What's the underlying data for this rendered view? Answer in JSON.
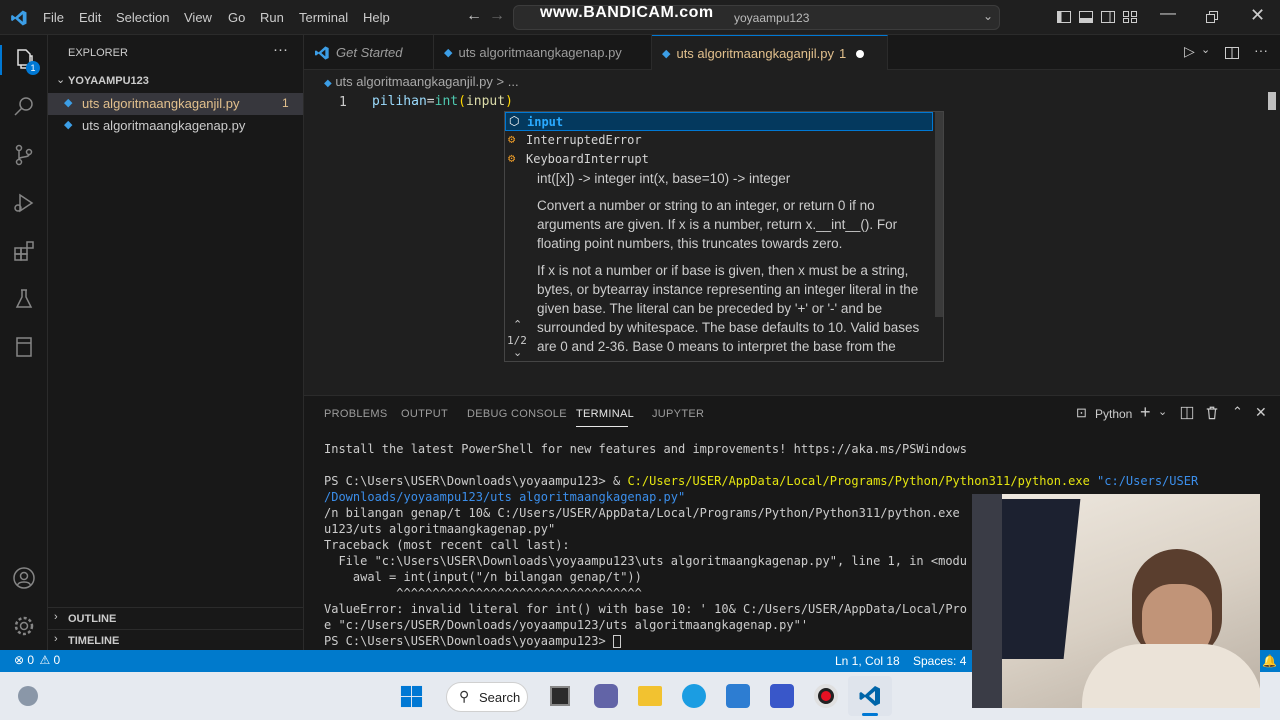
{
  "watermark": "www.BANDICAM.com",
  "menu": [
    "File",
    "Edit",
    "Selection",
    "View",
    "Go",
    "Run",
    "Terminal",
    "Help"
  ],
  "search": {
    "text": "yoyaampu123"
  },
  "explorer": {
    "title": "EXPLORER",
    "folder": "YOYAAMPU123",
    "files": [
      {
        "name": "uts algoritmaangkaganjil.py",
        "badge": "1"
      },
      {
        "name": "uts algoritmaangkagenap.py",
        "badge": ""
      }
    ],
    "outline": "OUTLINE",
    "timeline": "TIMELINE"
  },
  "activity_badge": "1",
  "tabs": [
    {
      "label": "Get Started"
    },
    {
      "label": "uts algoritmaangkagenap.py"
    },
    {
      "label": "uts algoritmaangkaganjil.py",
      "badge": "1"
    }
  ],
  "breadcrumb": {
    "file": "uts algoritmaangkaganjil.py",
    "sep": ">",
    "more": "..."
  },
  "editor": {
    "line_number": "1",
    "code_var": "pilihan",
    "code_eq": "=",
    "code_fn": "int",
    "code_open": "(",
    "code_arg": "input",
    "code_close": ")"
  },
  "suggestions": [
    {
      "label": "input"
    },
    {
      "label": "InterruptedError"
    },
    {
      "label": "KeyboardInterrupt"
    }
  ],
  "doc": {
    "signature": "int([x]) -> integer int(x, base=10) -> integer",
    "para1": "Convert a number or string to an integer, or return 0 if no arguments are given. If x is a number, return x.__int__(). For floating point numbers, this truncates towards zero.",
    "para2": "If x is not a number or if base is given, then x must be a string, bytes, or bytearray instance representing an integer literal in the given base. The literal can be preceded by '+' or '-' and be surrounded by whitespace. The base defaults to 10. Valid bases are 0 and 2-36. Base 0 means to interpret the base from the",
    "pager": "1/2"
  },
  "panel": {
    "tabs": [
      "PROBLEMS",
      "OUTPUT",
      "DEBUG CONSOLE",
      "TERMINAL",
      "JUPYTER"
    ],
    "active": "TERMINAL",
    "shell": "Python"
  },
  "terminal": {
    "l1": "Install the latest PowerShell for new features and improvements! https://aka.ms/PSWindows",
    "l2_prompt": "PS C:\\Users\\USER\\Downloads\\yoyaampu123> & ",
    "l2_exe": "C:/Users/USER/AppData/Local/Programs/Python/Python311/python.exe",
    "l2_arg": " \"c:/Users/USER",
    "l3": "/Downloads/yoyaampu123/uts algoritmaangkagenap.py\"",
    "l4": "/n bilangan genap/t 10& C:/Users/USER/AppData/Local/Programs/Python/Python311/python.exe",
    "l5": "u123/uts algoritmaangkagenap.py\"",
    "l6": "Traceback (most recent call last):",
    "l7": "  File \"c:\\Users\\USER\\Downloads\\yoyaampu123\\uts algoritmaangkagenap.py\", line 1, in <modu",
    "l8": "    awal = int(input(\"/n bilangan genap/t\"))",
    "l9": "          ^^^^^^^^^^^^^^^^^^^^^^^^^^^^^^^^^^",
    "l10": "ValueError: invalid literal for int() with base 10: ' 10& C:/Users/USER/AppData/Local/Pro",
    "l11": "e \"c:/Users/USER/Downloads/yoyaampu123/uts algoritmaangkagenap.py\"'",
    "l12": "PS C:\\Users\\USER\\Downloads\\yoyaampu123> "
  },
  "status": {
    "errors": "0",
    "warnings": "0",
    "position": "Ln 1, Col 18",
    "spaces": "Spaces: 4"
  },
  "taskbar": {
    "search": "Search"
  },
  "colors": {
    "accent": "#007acc",
    "active_tab_text": "#e2c08d",
    "terminal_path": "#e5e510",
    "terminal_string": "#3b8eea",
    "function": "#dcdcaa",
    "variable": "#9cdcfe",
    "match": "#2aaaff"
  }
}
